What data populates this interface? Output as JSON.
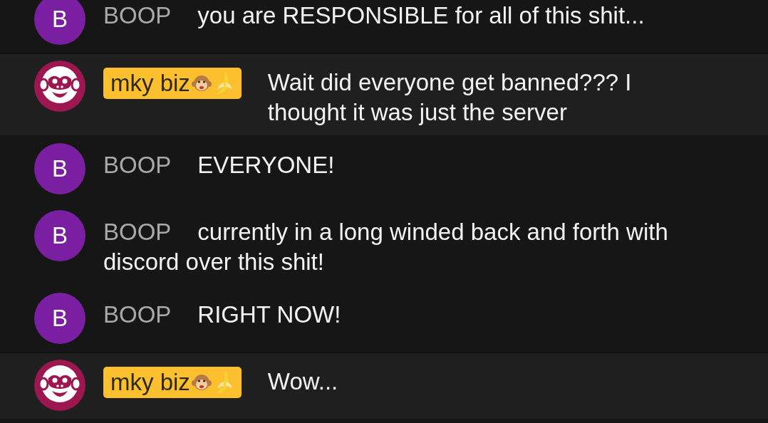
{
  "messages": [
    {
      "kind": "plain",
      "avatar": {
        "kind": "letter",
        "letter": "B",
        "color": "#7b1fa2"
      },
      "name": "BOOP",
      "text": "you are RESPONSIBLE for all of this shit..."
    },
    {
      "kind": "highlighted",
      "avatar": {
        "kind": "monkey",
        "color": "#9c1650"
      },
      "name": "mky biz",
      "text": "Wait did everyone get banned??? I thought it was just the server"
    },
    {
      "kind": "plain",
      "avatar": {
        "kind": "letter",
        "letter": "B",
        "color": "#7b1fa2"
      },
      "name": "BOOP",
      "text": "EVERYONE!"
    },
    {
      "kind": "plain",
      "avatar": {
        "kind": "letter",
        "letter": "B",
        "color": "#7b1fa2"
      },
      "name": "BOOP",
      "text": "currently in a long winded back and forth with discord over this shit!"
    },
    {
      "kind": "plain",
      "avatar": {
        "kind": "letter",
        "letter": "B",
        "color": "#7b1fa2"
      },
      "name": "BOOP",
      "text": "RIGHT NOW!"
    },
    {
      "kind": "highlighted",
      "avatar": {
        "kind": "monkey",
        "color": "#9c1650"
      },
      "name": "mky biz",
      "text": "Wow..."
    }
  ]
}
